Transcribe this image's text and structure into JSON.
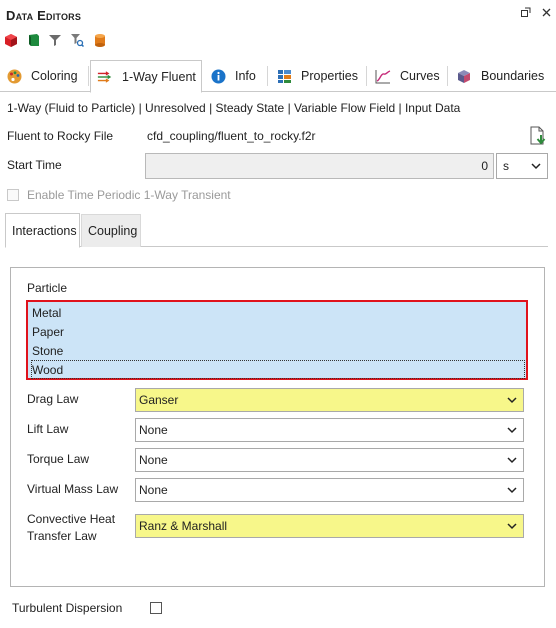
{
  "window": {
    "title": "Data Editors",
    "float_btn": "⭧",
    "close_btn": "✕"
  },
  "toolbar": {
    "icons": [
      "red-cube-icon",
      "green-book-icon",
      "funnel-icon",
      "search-filter-icon",
      "cylinder-icon"
    ]
  },
  "tabs": [
    {
      "label": "Coloring",
      "icon": "palette-icon"
    },
    {
      "label": "1-Way Fluent",
      "icon": "flow-arrows-icon",
      "active": true
    },
    {
      "label": "Info",
      "icon": "info-icon"
    },
    {
      "label": "Properties",
      "icon": "properties-grid-icon"
    },
    {
      "label": "Curves",
      "icon": "chart-curve-icon"
    },
    {
      "label": "Boundaries",
      "icon": "boundaries-icon"
    }
  ],
  "subtitle": "1-Way (Fluid to Particle) | Unresolved | Steady State | Variable Flow Field | Input Data",
  "fluent_file": {
    "label": "Fluent to Rocky File",
    "value": "cfd_coupling/fluent_to_rocky.f2r"
  },
  "start_time": {
    "label": "Start Time",
    "value": "0",
    "unit": "s"
  },
  "periodic": {
    "label": "Enable Time Periodic 1-Way Transient",
    "checked": false
  },
  "subtabs": [
    {
      "label": "Interactions",
      "active": true
    },
    {
      "label": "Coupling",
      "active": false
    }
  ],
  "particle": {
    "label": "Particle",
    "items": [
      "Metal",
      "Paper",
      "Stone",
      "Wood"
    ]
  },
  "laws": [
    {
      "label": "Drag Law",
      "value": "Ganser",
      "highlight": true
    },
    {
      "label": "Lift Law",
      "value": "None",
      "highlight": false
    },
    {
      "label": "Torque Law",
      "value": "None",
      "highlight": false
    },
    {
      "label": "Virtual Mass Law",
      "value": "None",
      "highlight": false
    },
    {
      "label_line1": "Convective Heat",
      "label_line2": "Transfer Law",
      "value": "Ranz & Marshall",
      "highlight": true
    }
  ],
  "turbulent": {
    "label": "Turbulent Dispersion",
    "checked": false
  },
  "colors": {
    "selection": "#cce4f7",
    "highlight_yellow": "#f7f78a",
    "list_border": "#e0121c"
  }
}
